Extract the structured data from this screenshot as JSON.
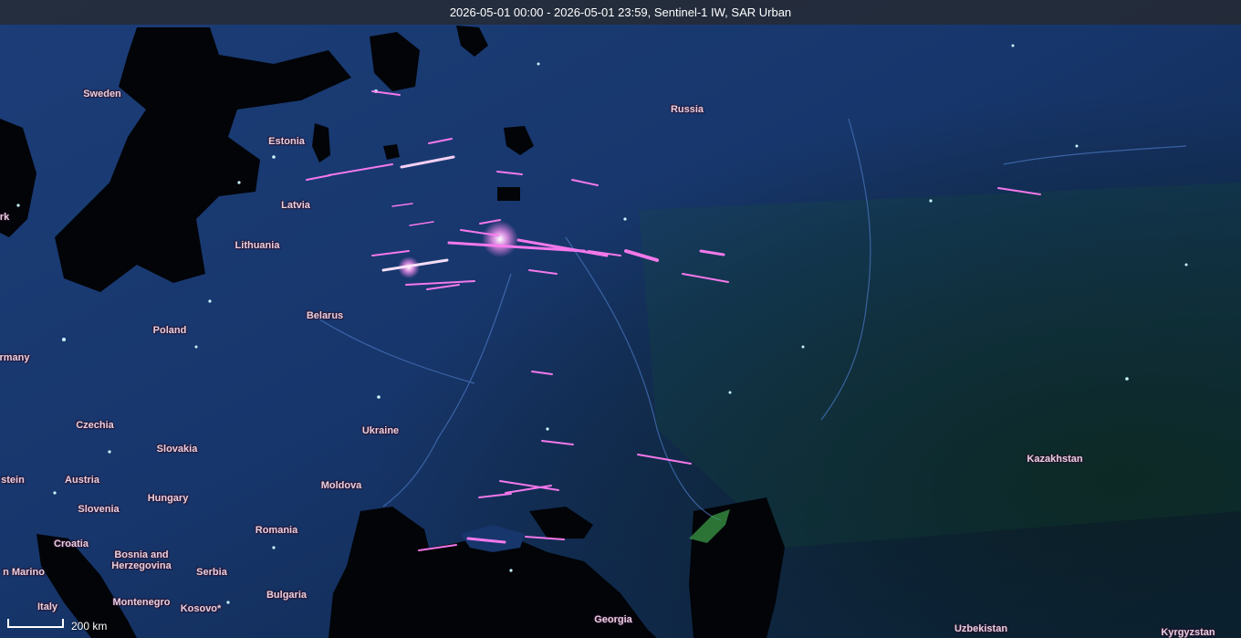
{
  "title": "2026-05-01 00:00 - 2026-05-01 23:59, Sentinel-1 IW,  SAR Urban",
  "scale_label": "200 km",
  "colors": {
    "land": "#1c3f7a",
    "water": "#020408",
    "urban_highlight": "#ff7cf2",
    "vegetation": "#1f6a2a"
  },
  "labels": {
    "sweden": "Sweden",
    "estonia": "Estonia",
    "latvia": "Latvia",
    "lithuania": "Lithuania",
    "russia": "Russia",
    "belarus": "Belarus",
    "poland": "Poland",
    "germany": "rmany",
    "czechia": "Czechia",
    "slovakia": "Slovakia",
    "austria": "Austria",
    "liechtenstein": "stein",
    "ukraine": "Ukraine",
    "moldova": "Moldova",
    "hungary": "Hungary",
    "slovenia": "Slovenia",
    "croatia": "Croatia",
    "romania": "Romania",
    "bosnia": "Bosnia and\nHerzegovina",
    "serbia": "Serbia",
    "san_marino": "n Marino",
    "montenegro": "Montenegro",
    "kosovo": "Kosovo*",
    "bulgaria": "Bulgaria",
    "italy": "Italy",
    "georgia": "Georgia",
    "kazakhstan": "Kazakhstan",
    "uzbekistan": "Uzbekistan",
    "kyrgyzstan": "Kyrgyzstan",
    "denmark": "rk"
  }
}
